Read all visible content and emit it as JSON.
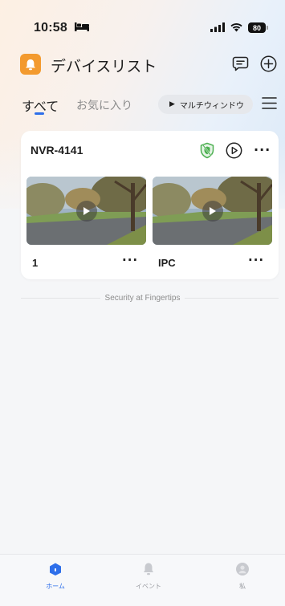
{
  "status_bar": {
    "time": "10:58",
    "battery": "80"
  },
  "header": {
    "title": "デバイスリスト"
  },
  "tabs": {
    "all": "すべて",
    "favorites": "お気に入り",
    "multi_window": "マルチウィンドウ"
  },
  "device": {
    "name": "NVR-4141",
    "more": "···",
    "cameras": [
      {
        "name": "1",
        "more": "···"
      },
      {
        "name": "IPC",
        "more": "···"
      }
    ]
  },
  "footer": {
    "tagline": "Security at Fingertips"
  },
  "bottom_nav": {
    "items": [
      {
        "label": "ホーム",
        "icon": "home-icon"
      },
      {
        "label": "イベント",
        "icon": "bell-icon"
      },
      {
        "label": "私",
        "icon": "person-icon"
      }
    ]
  },
  "colors": {
    "accent": "#2e6fea",
    "logo": "#f39a2e",
    "shield": "#4caf50"
  }
}
